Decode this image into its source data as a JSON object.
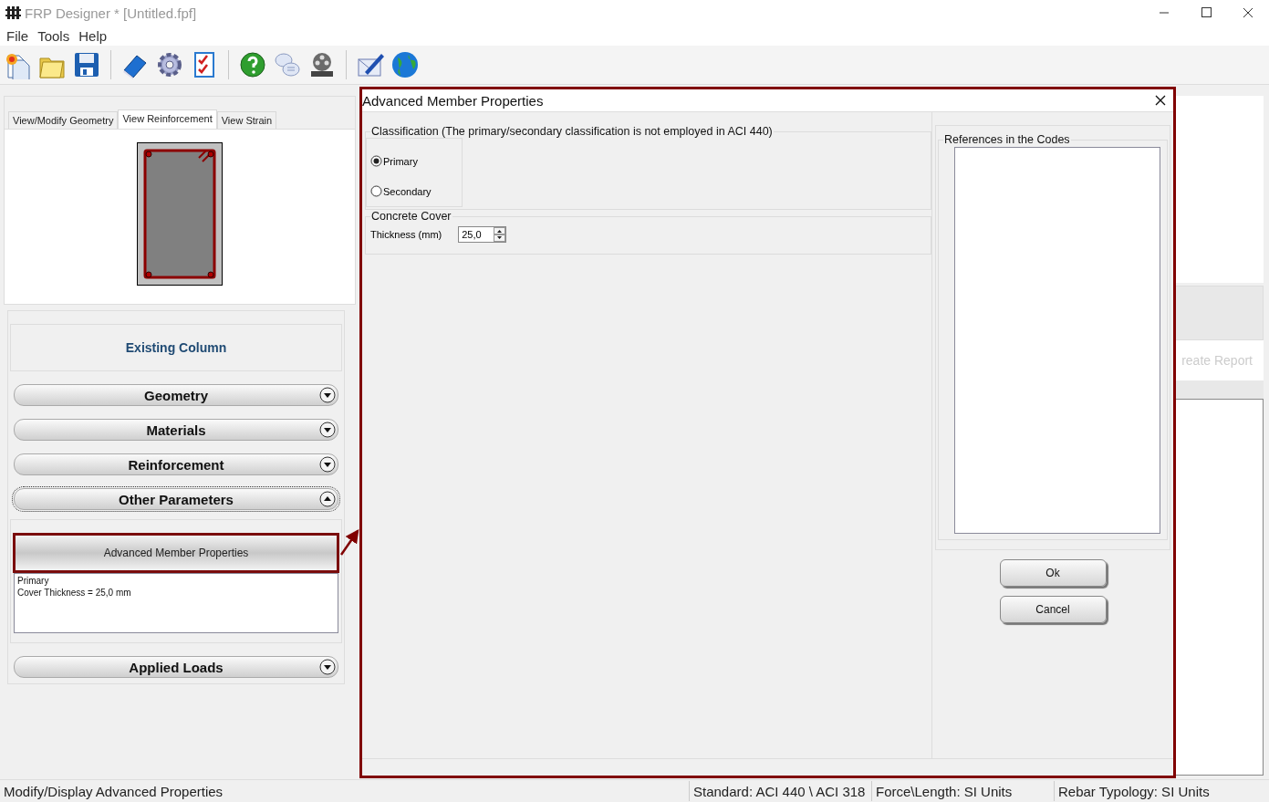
{
  "window": {
    "title": "FRP Designer * [Untitled.fpf]"
  },
  "menu": [
    "File",
    "Tools",
    "Help"
  ],
  "view_tabs": [
    {
      "label": "View/Modify Geometry",
      "selected": false
    },
    {
      "label": "View Reinforcement",
      "selected": true
    },
    {
      "label": "View Strain",
      "selected": false
    }
  ],
  "panel_title": "Existing Column",
  "sections": [
    {
      "label": "Geometry",
      "expanded": false
    },
    {
      "label": "Materials",
      "expanded": false
    },
    {
      "label": "Reinforcement",
      "expanded": false
    },
    {
      "label": "Other Parameters",
      "expanded": true,
      "button": "Advanced Member Properties",
      "summary": [
        "Primary",
        "Cover Thickness = 25,0 mm"
      ]
    },
    {
      "label": "Applied Loads",
      "expanded": false
    }
  ],
  "right_panel": {
    "button": "reate Report"
  },
  "dialog": {
    "title": "Advanced Member Properties",
    "classification": {
      "legend": "Classification (The primary/secondary classification is not employed in ACI 440)",
      "options": [
        {
          "label": "Primary",
          "selected": true
        },
        {
          "label": "Secondary",
          "selected": false
        }
      ]
    },
    "cover": {
      "legend": "Concrete Cover",
      "label": "Thickness (mm)",
      "value": "25,0"
    },
    "references": {
      "legend": "References in the Codes"
    },
    "buttons": [
      "Ok",
      "Cancel"
    ]
  },
  "status_bar": [
    "Modify/Display Advanced Properties",
    "Standard: ACI 440 \\ ACI 318",
    "Force\\Length: SI Units",
    "Rebar Typology: SI Units"
  ]
}
